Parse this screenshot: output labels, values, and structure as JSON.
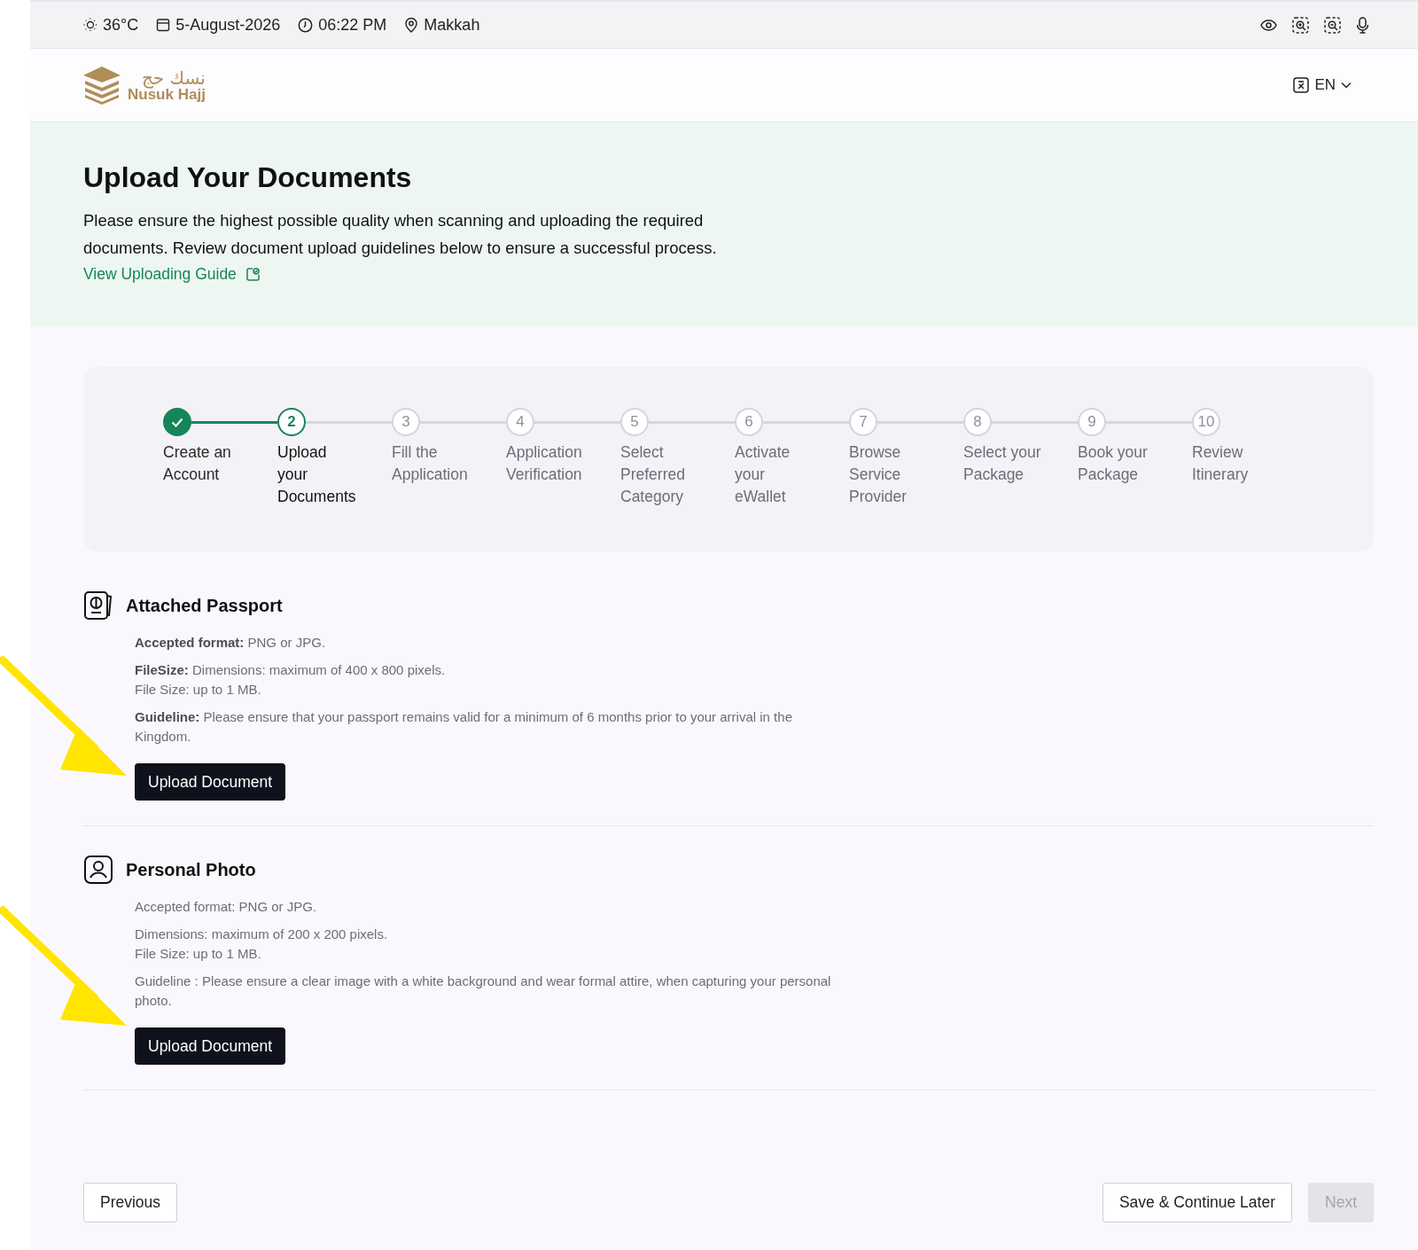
{
  "top_bar": {
    "temperature": "36°C",
    "date": "5-August-2026",
    "time": "06:22 PM",
    "location": "Makkah"
  },
  "header": {
    "logo_arabic": "نسك حج",
    "logo_text": "Nusuk Hajj",
    "language": "EN"
  },
  "hero": {
    "title": "Upload Your Documents",
    "description": "Please ensure the highest possible quality when scanning and uploading the required documents. Review document upload guidelines below to ensure a successful process.",
    "guide_link": "View Uploading Guide"
  },
  "steps": [
    {
      "label": "Create an Account",
      "completed": true,
      "selected": false
    },
    {
      "number": "2",
      "label": "Upload your Documents",
      "completed": false,
      "selected": true
    },
    {
      "number": "3",
      "label": "Fill the Application",
      "completed": false,
      "selected": false
    },
    {
      "number": "4",
      "label": "Application Verification",
      "completed": false,
      "selected": false
    },
    {
      "number": "5",
      "label": "Select Preferred Category",
      "completed": false,
      "selected": false
    },
    {
      "number": "6",
      "label": "Activate your eWallet",
      "completed": false,
      "selected": false
    },
    {
      "number": "7",
      "label": "Browse Service Provider",
      "completed": false,
      "selected": false
    },
    {
      "number": "8",
      "label": "Select your Package",
      "completed": false,
      "selected": false
    },
    {
      "number": "9",
      "label": "Book your Package",
      "completed": false,
      "selected": false
    },
    {
      "number": "10",
      "label": "Review Itinerary",
      "completed": false,
      "selected": false
    }
  ],
  "sections": [
    {
      "kind": "passport",
      "title": "Attached Passport",
      "annotated": true,
      "notes": [
        [
          "**Accepted format:** PNG or JPG."
        ],
        [
          "**FileSize:** Dimensions: maximum of 400 x 800 pixels.",
          "File Size: up to 1 MB."
        ],
        [
          "**Guideline:** Please ensure that your passport remains valid for a minimum of 6 months prior to your arrival in the Kingdom."
        ]
      ],
      "button": "Upload Document"
    },
    {
      "kind": "photo",
      "title": "Personal Photo",
      "annotated": true,
      "notes": [
        [
          "Accepted format: PNG or JPG."
        ],
        [
          "Dimensions: maximum of 200 x 200 pixels.",
          "File Size: up to 1 MB."
        ],
        [
          "Guideline : Please ensure a clear image with a white background and wear formal attire, when capturing your personal photo."
        ]
      ],
      "button": "Upload Document"
    }
  ],
  "footer": {
    "previous": "Previous",
    "save": "Save & Continue Later",
    "next": "Next",
    "next_disabled": true
  }
}
